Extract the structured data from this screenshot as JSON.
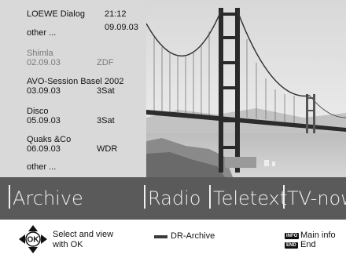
{
  "header": {
    "title": "LOEWE Dialog",
    "time": "21:12",
    "date": "09.09.03",
    "other_top": "other ..."
  },
  "entries": [
    {
      "title": "Shimla",
      "date": "02.09.03",
      "channel": "ZDF",
      "dimmed": true
    },
    {
      "title": "AVO-Session Basel 2002",
      "date": "03.09.03",
      "channel": "3Sat",
      "dimmed": false
    },
    {
      "title": "Disco",
      "date": "05.09.03",
      "channel": "3Sat",
      "dimmed": false
    },
    {
      "title": "Quaks &Co",
      "date": "06.09.03",
      "channel": "WDR",
      "dimmed": false
    }
  ],
  "other_bottom": "other ...",
  "menu": {
    "tabs": [
      {
        "label": "Archive",
        "selected": true
      },
      {
        "label": "Radio",
        "selected": false
      },
      {
        "label": "Teletext",
        "selected": false
      },
      {
        "label": "TV-now",
        "selected": false
      }
    ]
  },
  "help": {
    "ok_label": "OK",
    "select_text_1": "Select and view",
    "select_text_2": "with OK",
    "dr_archive": "DR-Archive",
    "info_key": "INFO",
    "info_text": "Main info",
    "end_key": "END",
    "end_text": "End"
  },
  "colors": {
    "list_bg": "#d9d9d9",
    "menu_bg": "#5a5a5a",
    "menu_text": "#f0f0f0",
    "dimmed_text": "#7a7a7a"
  },
  "icons": {
    "nav": "ok-navigation-pad-icon",
    "dr": "dr-archive-button-icon"
  }
}
